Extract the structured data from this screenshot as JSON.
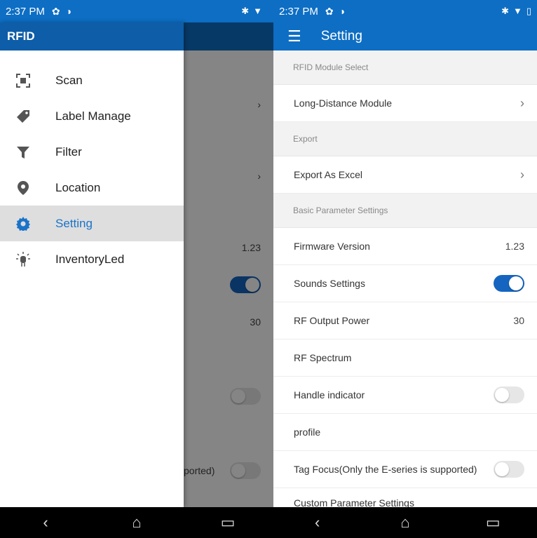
{
  "status_left": {
    "time": "2:37 PM",
    "icons": [
      "gear-icon",
      "data-saver-icon"
    ],
    "right_icons": [
      "bluetooth-icon",
      "wifi-icon",
      "battery-icon"
    ]
  },
  "status_right": {
    "time": "2:37 PM"
  },
  "drawer": {
    "title": "RFID",
    "items": [
      {
        "label": "Scan",
        "icon": "scan-icon",
        "active": false
      },
      {
        "label": "Label Manage",
        "icon": "tag-icon",
        "active": false
      },
      {
        "label": "Filter",
        "icon": "filter-icon",
        "active": false
      },
      {
        "label": "Location",
        "icon": "location-icon",
        "active": false
      },
      {
        "label": "Setting",
        "icon": "gear-icon",
        "active": true
      },
      {
        "label": "InventoryLed",
        "icon": "led-icon",
        "active": false
      }
    ]
  },
  "background_values": {
    "version": "1.23",
    "power": "30",
    "partial_text": "ported)"
  },
  "settings": {
    "title": "Setting",
    "sections": {
      "rfid": "RFID Module Select",
      "export": "Export",
      "basic": "Basic Parameter Settings",
      "custom": "Custom Parameter Settings"
    },
    "rows": {
      "module": "Long-Distance Module",
      "export_excel": "Export As Excel",
      "firmware": "Firmware Version",
      "firmware_value": "1.23",
      "sounds": "Sounds Settings",
      "sounds_on": true,
      "rf_power": "RF Output Power",
      "rf_power_value": "30",
      "rf_spectrum": "RF Spectrum",
      "handle": "Handle indicator",
      "handle_on": false,
      "profile": "profile",
      "tag_focus": "Tag Focus(Only the E-series is supported)",
      "tag_focus_on": false
    }
  },
  "colors": {
    "primary": "#0d6ec4",
    "accent": "#1565c0",
    "active_bg": "#dedede"
  }
}
